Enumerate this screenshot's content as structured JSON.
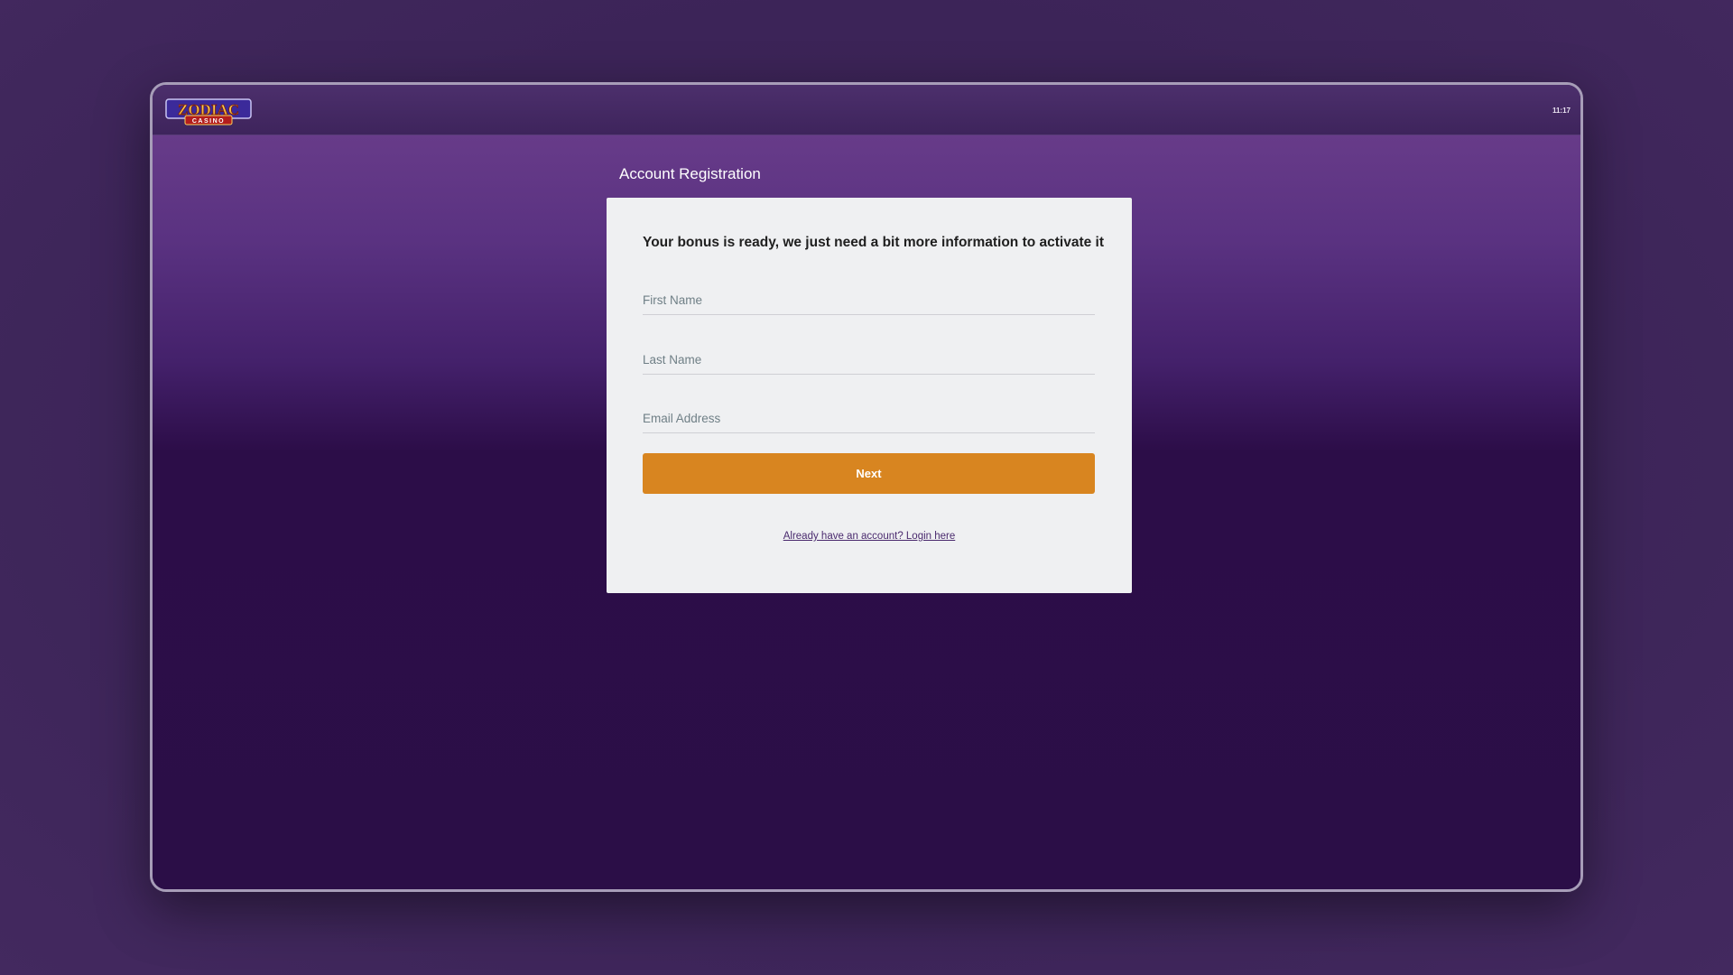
{
  "header": {
    "logo_text": "ZODIAC",
    "logo_subtext": "CASINO",
    "clock": "11:17"
  },
  "page": {
    "title": "Account Registration"
  },
  "form": {
    "heading": "Your bonus is ready, we just need a bit more information to activate it",
    "first_name_placeholder": "First Name",
    "last_name_placeholder": "Last Name",
    "email_placeholder": "Email Address",
    "next_label": "Next",
    "login_link": "Already have an account? Login here"
  },
  "colors": {
    "accent": "#d88520",
    "background": "#2b0e47",
    "card": "#eff0f2"
  }
}
